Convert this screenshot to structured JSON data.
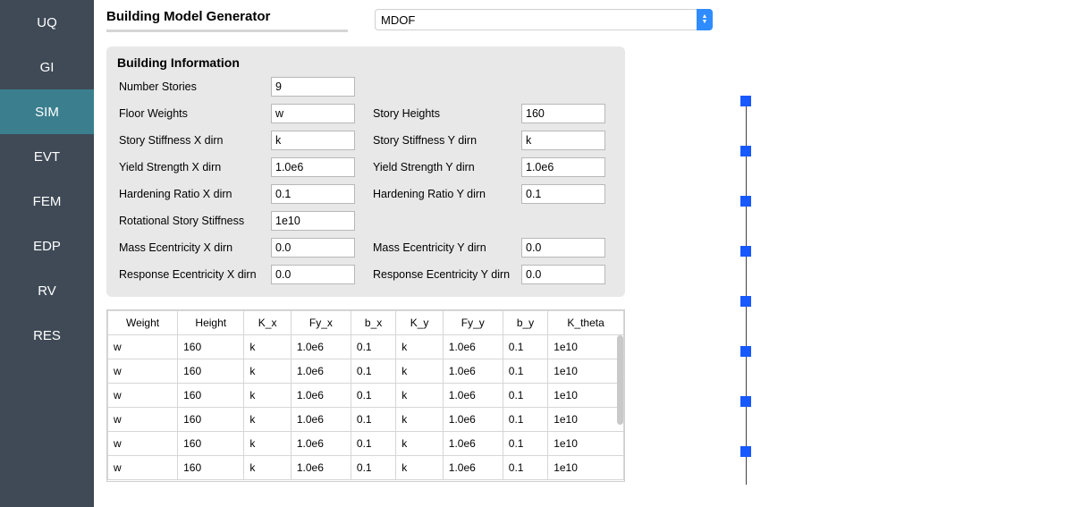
{
  "sidebar": {
    "items": [
      {
        "label": "UQ"
      },
      {
        "label": "GI"
      },
      {
        "label": "SIM"
      },
      {
        "label": "EVT"
      },
      {
        "label": "FEM"
      },
      {
        "label": "EDP"
      },
      {
        "label": "RV"
      },
      {
        "label": "RES"
      }
    ],
    "active_index": 2
  },
  "header": {
    "title": "Building Model Generator",
    "combo_value": "MDOF"
  },
  "info": {
    "title": "Building Information",
    "fields": {
      "number_stories_label": "Number Stories",
      "number_stories": "9",
      "floor_weights_label": "Floor Weights",
      "floor_weights": "w",
      "story_heights_label": "Story Heights",
      "story_heights": "160",
      "stiff_x_label": "Story Stiffness X dirn",
      "stiff_x": "k",
      "stiff_y_label": "Story Stiffness Y dirn",
      "stiff_y": "k",
      "yield_x_label": "Yield Strength X dirn",
      "yield_x": "1.0e6",
      "yield_y_label": "Yield Strength Y dirn",
      "yield_y": "1.0e6",
      "hard_x_label": "Hardening Ratio X dirn",
      "hard_x": "0.1",
      "hard_y_label": "Hardening Ratio Y dirn",
      "hard_y": "0.1",
      "rot_label": "Rotational Story Stiffness",
      "rot": "1e10",
      "mass_x_label": "Mass Ecentricity X dirn",
      "mass_x": "0.0",
      "mass_y_label": "Mass Ecentricity Y dirn",
      "mass_y": "0.0",
      "resp_x_label": "Response Ecentricity X dirn",
      "resp_x": "0.0",
      "resp_y_label": "Response Ecentricity Y dirn",
      "resp_y": "0.0"
    }
  },
  "table": {
    "headers": [
      "Weight",
      "Height",
      "K_x",
      "Fy_x",
      "b_x",
      "K_y",
      "Fy_y",
      "b_y",
      "K_theta"
    ],
    "rows": [
      [
        "w",
        "160",
        "k",
        "1.0e6",
        "0.1",
        "k",
        "1.0e6",
        "0.1",
        "1e10"
      ],
      [
        "w",
        "160",
        "k",
        "1.0e6",
        "0.1",
        "k",
        "1.0e6",
        "0.1",
        "1e10"
      ],
      [
        "w",
        "160",
        "k",
        "1.0e6",
        "0.1",
        "k",
        "1.0e6",
        "0.1",
        "1e10"
      ],
      [
        "w",
        "160",
        "k",
        "1.0e6",
        "0.1",
        "k",
        "1.0e6",
        "0.1",
        "1e10"
      ],
      [
        "w",
        "160",
        "k",
        "1.0e6",
        "0.1",
        "k",
        "1.0e6",
        "0.1",
        "1e10"
      ],
      [
        "w",
        "160",
        "k",
        "1.0e6",
        "0.1",
        "k",
        "1.0e6",
        "0.1",
        "1e10"
      ]
    ]
  },
  "viz": {
    "node_count": 8,
    "node_top_start": 55,
    "node_spacing": 56
  }
}
